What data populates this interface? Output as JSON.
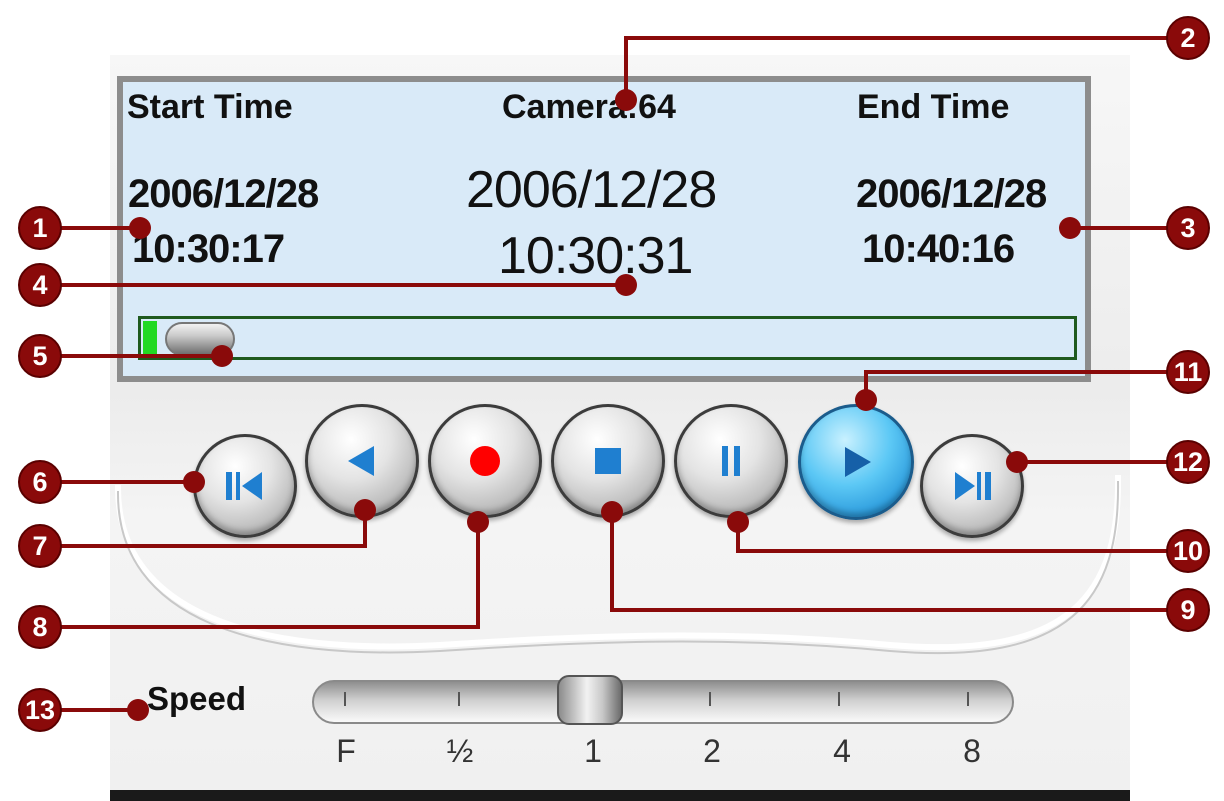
{
  "display": {
    "start_label": "Start Time",
    "camera_label": "Camera:64",
    "end_label": "End Time",
    "start_date": "2006/12/28",
    "start_time": "10:30:17",
    "current_date": "2006/12/28",
    "current_time": "10:30:31",
    "end_date": "2006/12/28",
    "end_time": "10:40:16",
    "progress_fraction": 0.0
  },
  "controls": {
    "buttons": [
      "go-to-start",
      "rewind",
      "record",
      "stop",
      "pause",
      "play",
      "go-to-end"
    ],
    "active": "play"
  },
  "speed": {
    "label": "Speed",
    "ticks": [
      "F",
      "½",
      "1",
      "2",
      "4",
      "8"
    ],
    "selected": "1"
  },
  "callouts": [
    "1",
    "2",
    "3",
    "4",
    "5",
    "6",
    "7",
    "8",
    "9",
    "10",
    "11",
    "12",
    "13"
  ],
  "colors": {
    "callout": "#8a0a0a",
    "display_bg": "#d9eaf8",
    "progress_fill": "#22d922",
    "play_button": "#3ab0ea",
    "record_dot": "#ff0000",
    "icon_blue": "#1f7fd0"
  }
}
